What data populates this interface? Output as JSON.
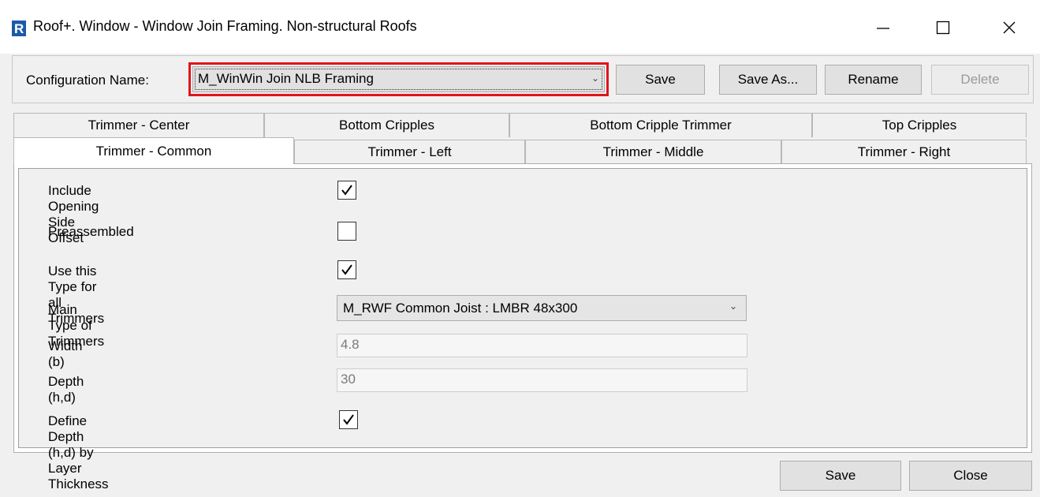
{
  "window": {
    "title": "Roof+. Window - Window Join Framing. Non-structural Roofs",
    "app_icon": "revit-r-icon",
    "controls": {
      "minimize": "minimize-icon",
      "maximize": "maximize-icon",
      "close": "close-icon"
    }
  },
  "config": {
    "label": "Configuration Name:",
    "selected": "M_WinWin Join NLB Framing",
    "buttons": {
      "save": "Save",
      "save_as": "Save As...",
      "rename": "Rename",
      "delete": "Delete"
    }
  },
  "tabs": {
    "row1": [
      "Trimmer - Center",
      "Bottom Cripples",
      "Bottom Cripple Trimmer",
      "Top Cripples"
    ],
    "row2": [
      "Trimmer - Common",
      "Trimmer - Left",
      "Trimmer - Middle",
      "Trimmer - Right"
    ],
    "active": "Trimmer - Common"
  },
  "form": {
    "include_opening_side_offset": {
      "label": "Include Opening Side Offset",
      "checked": true
    },
    "preassembled": {
      "label": "Preassembled",
      "checked": false
    },
    "use_type_for_all": {
      "label": "Use this Type for all Trimmers",
      "checked": true
    },
    "main_type": {
      "label": "Main Type of Trimmers",
      "value": "M_RWF Common Joist : LMBR 48x300"
    },
    "width": {
      "label": "Width (b)",
      "value": "4.8"
    },
    "depth": {
      "label": "Depth (h,d)",
      "value": "30"
    },
    "define_depth": {
      "label": "Define Depth (h,d) by Layer Thickness",
      "checked": true
    }
  },
  "footer": {
    "save": "Save",
    "close": "Close"
  },
  "colors": {
    "highlight_border": "#e0141c",
    "revit_icon": "#1c5aa6"
  }
}
